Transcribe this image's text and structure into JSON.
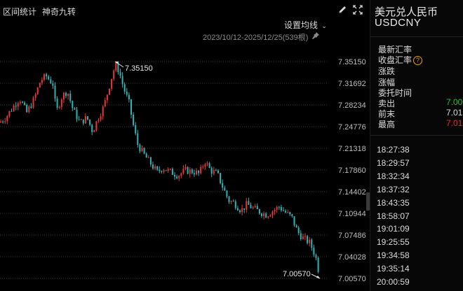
{
  "toolbar": {
    "range_stats": "区间统计",
    "magic_nine": "神奇九转",
    "set_average": "设置均线",
    "date_range": "2023/10/12-2025/12/25(539根)"
  },
  "quote": {
    "name": "美元兑人民币",
    "code": "USDCNY",
    "labels": {
      "latest": "最新汇率",
      "close": "收盘汇率",
      "change": "涨跌",
      "change_pct": "涨幅",
      "order_time": "委托时间",
      "sell": "卖出",
      "prev": "前末",
      "high": "最高"
    },
    "values": {
      "sell": "7.00",
      "prev": "7.01",
      "high": "7.01"
    },
    "colors": {
      "green": "#19c52f",
      "red": "#ef2a2a",
      "white": "#dcdcdc"
    }
  },
  "trades": {
    "times": [
      "18:27:38",
      "18:29:57",
      "18:32:34",
      "18:37:32",
      "18:43:35",
      "18:58:07",
      "19:01:09",
      "19:25:55",
      "19:34:58",
      "19:35:14",
      "20:00:59"
    ]
  },
  "chart_data": {
    "type": "candlestick",
    "y_ticks": [
      "7.35150",
      "7.31692",
      "7.28234",
      "7.24776",
      "7.21318",
      "7.17860",
      "7.14402",
      "7.10944",
      "7.07486",
      "7.04028",
      "7.00570"
    ],
    "ylim": [
      7.0057,
      7.3515
    ],
    "grid": true,
    "up_color": "#e8353a",
    "down_color": "#2fb3b3",
    "annotations": [
      {
        "label": "7.35150",
        "value": 7.3515,
        "kind": "max"
      },
      {
        "label": "7.00570",
        "value": 7.0057,
        "kind": "min"
      }
    ],
    "close_path": [
      [
        0,
        7.255
      ],
      [
        8,
        7.262
      ],
      [
        18,
        7.278
      ],
      [
        28,
        7.293
      ],
      [
        38,
        7.27
      ],
      [
        48,
        7.29
      ],
      [
        58,
        7.322
      ],
      [
        66,
        7.328
      ],
      [
        76,
        7.315
      ],
      [
        80,
        7.27
      ],
      [
        88,
        7.295
      ],
      [
        96,
        7.305
      ],
      [
        104,
        7.275
      ],
      [
        114,
        7.254
      ],
      [
        124,
        7.262
      ],
      [
        132,
        7.24
      ],
      [
        140,
        7.262
      ],
      [
        148,
        7.28
      ],
      [
        154,
        7.305
      ],
      [
        160,
        7.33
      ],
      [
        165,
        7.348
      ],
      [
        170,
        7.335
      ],
      [
        176,
        7.31
      ],
      [
        184,
        7.285
      ],
      [
        190,
        7.25
      ],
      [
        196,
        7.22
      ],
      [
        204,
        7.205
      ],
      [
        214,
        7.19
      ],
      [
        224,
        7.175
      ],
      [
        232,
        7.182
      ],
      [
        242,
        7.176
      ],
      [
        254,
        7.17
      ],
      [
        264,
        7.178
      ],
      [
        276,
        7.176
      ],
      [
        284,
        7.172
      ],
      [
        292,
        7.193
      ],
      [
        300,
        7.178
      ],
      [
        310,
        7.172
      ],
      [
        318,
        7.15
      ],
      [
        326,
        7.13
      ],
      [
        334,
        7.126
      ],
      [
        344,
        7.114
      ],
      [
        352,
        7.124
      ],
      [
        360,
        7.118
      ],
      [
        370,
        7.112
      ],
      [
        380,
        7.107
      ],
      [
        388,
        7.113
      ],
      [
        398,
        7.12
      ],
      [
        408,
        7.11
      ],
      [
        416,
        7.103
      ],
      [
        424,
        7.08
      ],
      [
        432,
        7.07
      ],
      [
        442,
        7.062
      ],
      [
        450,
        7.04
      ],
      [
        456,
        7.008
      ]
    ]
  }
}
